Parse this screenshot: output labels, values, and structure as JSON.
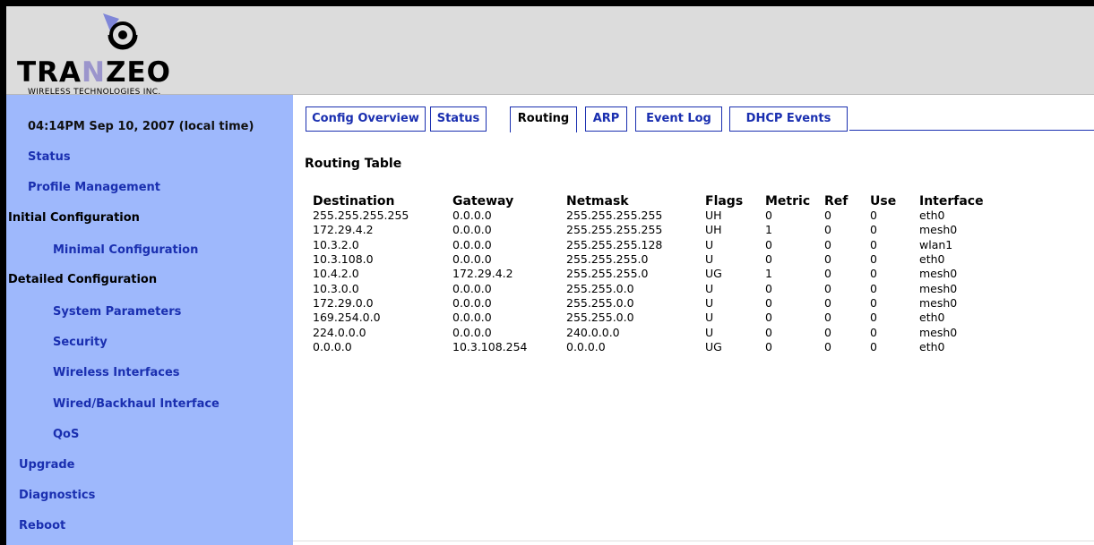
{
  "header": {
    "logo_text": "TRANZEO",
    "logo_subtitle": "WIRELESS TECHNOLOGIES INC.",
    "brand_colors": {
      "accent": "#9b95cc",
      "sidebar": "#9eb8fc",
      "link": "#1a2fb0"
    }
  },
  "sidebar": {
    "clock": "04:14PM Sep 10, 2007 (local time)",
    "items": [
      {
        "label": "Status"
      },
      {
        "label": "Profile Management"
      },
      {
        "label": "Initial Configuration"
      },
      {
        "label": "Minimal Configuration"
      },
      {
        "label": "Detailed Configuration"
      },
      {
        "label": "System Parameters"
      },
      {
        "label": "Security"
      },
      {
        "label": "Wireless Interfaces"
      },
      {
        "label": "Wired/Backhaul Interface"
      },
      {
        "label": "QoS"
      },
      {
        "label": "Upgrade"
      },
      {
        "label": "Diagnostics"
      },
      {
        "label": "Reboot"
      }
    ]
  },
  "tabs": [
    {
      "label": "Config Overview"
    },
    {
      "label": "Status"
    },
    {
      "label": "Routing",
      "active": true
    },
    {
      "label": "ARP"
    },
    {
      "label": "Event Log"
    },
    {
      "label": "DHCP Events"
    }
  ],
  "main": {
    "title": "Routing Table",
    "columns": [
      "Destination",
      "Gateway",
      "Netmask",
      "Flags",
      "Metric",
      "Ref",
      "Use",
      "Interface"
    ],
    "rows": [
      [
        "255.255.255.255",
        "0.0.0.0",
        "255.255.255.255",
        "UH",
        "0",
        "0",
        "0",
        "eth0"
      ],
      [
        "172.29.4.2",
        "0.0.0.0",
        "255.255.255.255",
        "UH",
        "1",
        "0",
        "0",
        "mesh0"
      ],
      [
        "10.3.2.0",
        "0.0.0.0",
        "255.255.255.128",
        "U",
        "0",
        "0",
        "0",
        "wlan1"
      ],
      [
        "10.3.108.0",
        "0.0.0.0",
        "255.255.255.0",
        "U",
        "0",
        "0",
        "0",
        "eth0"
      ],
      [
        "10.4.2.0",
        "172.29.4.2",
        "255.255.255.0",
        "UG",
        "1",
        "0",
        "0",
        "mesh0"
      ],
      [
        "10.3.0.0",
        "0.0.0.0",
        "255.255.0.0",
        "U",
        "0",
        "0",
        "0",
        "mesh0"
      ],
      [
        "172.29.0.0",
        "0.0.0.0",
        "255.255.0.0",
        "U",
        "0",
        "0",
        "0",
        "mesh0"
      ],
      [
        "169.254.0.0",
        "0.0.0.0",
        "255.255.0.0",
        "U",
        "0",
        "0",
        "0",
        "eth0"
      ],
      [
        "224.0.0.0",
        "0.0.0.0",
        "240.0.0.0",
        "U",
        "0",
        "0",
        "0",
        "mesh0"
      ],
      [
        "0.0.0.0",
        "10.3.108.254",
        "0.0.0.0",
        "UG",
        "0",
        "0",
        "0",
        "eth0"
      ]
    ]
  }
}
